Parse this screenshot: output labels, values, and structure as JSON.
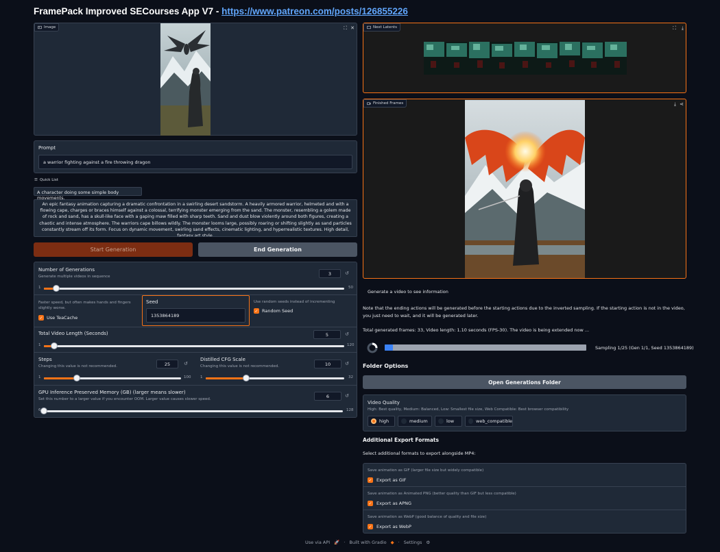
{
  "title": {
    "text": "FramePack Improved SECourses App V7 - ",
    "link": "https://www.patreon.com/posts/126855226"
  },
  "image_panel": {
    "label": "Image"
  },
  "latents_panel": {
    "label": "Next Latents"
  },
  "frames_panel": {
    "label": "Finished Frames"
  },
  "prompt": {
    "label": "Prompt",
    "value": "a warrior fighting against a fire throwing dragon"
  },
  "quick_list": {
    "label": "Quick List",
    "items": [
      "A character doing some simple body movements.",
      "An epic fantasy animation capturing a dramatic confrontation in a swirling desert sandstorm. A heavily armored warrior, helmeted and with a flowing cape, charges or braces himself against a colossal, terrifying monster emerging from the sand. The monster, resembling a golem made of rock and sand, has a skull-like face with a gaping maw filled with sharp teeth. Sand and dust blow violently around both figures, creating a chaotic and intense atmosphere. The warriors cape billows wildly. The monster looms large, possibly roaring or shifting slightly as sand particles constantly stream off its form. Focus on dynamic movement, swirling sand effects, cinematic lighting, and hyperrealistic textures. High detail, fantasy art style."
    ]
  },
  "buttons": {
    "start": "Start Generation",
    "end": "End Generation",
    "open_folder": "Open Generations Folder"
  },
  "num_generations": {
    "label": "Number of Generations",
    "info": "Generate multiple videos in sequence",
    "value": "3",
    "min": "1",
    "max": "50",
    "fraction": 0.04
  },
  "teacache": {
    "info": "Faster speed, but often makes hands and fingers slightly worse.",
    "label": "Use TeaCache"
  },
  "seed": {
    "label": "Seed",
    "value": "1353864189"
  },
  "random_seed": {
    "info": "Use random seeds instead of incrementing",
    "label": "Random Seed"
  },
  "video_length": {
    "label": "Total Video Length (Seconds)",
    "value": "5",
    "min": "1",
    "max": "120",
    "fraction": 0.034
  },
  "steps": {
    "label": "Steps",
    "info": "Changing this value is not recommended.",
    "value": "25",
    "min": "1",
    "max": "100",
    "fraction": 0.24
  },
  "cfg": {
    "label": "Distilled CFG Scale",
    "info": "Changing this value is not recommended.",
    "value": "10",
    "min": "1",
    "max": "32",
    "fraction": 0.29
  },
  "gpu_memory": {
    "label": "GPU Inference Preserved Memory (GB) (larger means slower)",
    "info": "Set this number to a larger value if you encounter OOM. Larger value causes slower speed.",
    "value": "6",
    "min": "6",
    "max": "128",
    "fraction": 0.0
  },
  "info": {
    "line1": "Generate a video to see information",
    "line2": "Note that the ending actions will be generated before the starting actions due to the inverted sampling. If the starting action is not in the video, you just need to wait, and it will be generated later.",
    "line3": "Total generated frames: 33, Video length: 1.10 seconds (FPS-30). The video is being extended now ..."
  },
  "progress": {
    "text": "Sampling 1/25 (Gen 1/1, Seed 1353864189)",
    "fraction": 0.04
  },
  "folder_options": {
    "heading": "Folder Options"
  },
  "video_quality": {
    "label": "Video Quality",
    "info": "High: Best quality, Medium: Balanced, Low: Smallest file size, Web Compatible: Best browser compatibility",
    "options": [
      "high",
      "medium",
      "low",
      "web_compatible"
    ],
    "selected": "high"
  },
  "export": {
    "heading": "Additional Export Formats",
    "subtitle": "Select additional formats to export alongside MP4:",
    "gif": {
      "info": "Save animation as GIF (larger file size but widely compatible)",
      "label": "Export as GIF"
    },
    "apng": {
      "info": "Save animation as Animated PNG (better quality than GIF but less compatible)",
      "label": "Export as APNG"
    },
    "webp": {
      "info": "Save animation as WebP (good balance of quality and file size)",
      "label": "Export as WebP"
    }
  },
  "footer": {
    "api": "Use via API",
    "built": "Built with Gradio",
    "settings": "Settings"
  },
  "colors": {
    "accent": "#f97316",
    "background": "#0b0f19",
    "panel": "#1f2937"
  }
}
